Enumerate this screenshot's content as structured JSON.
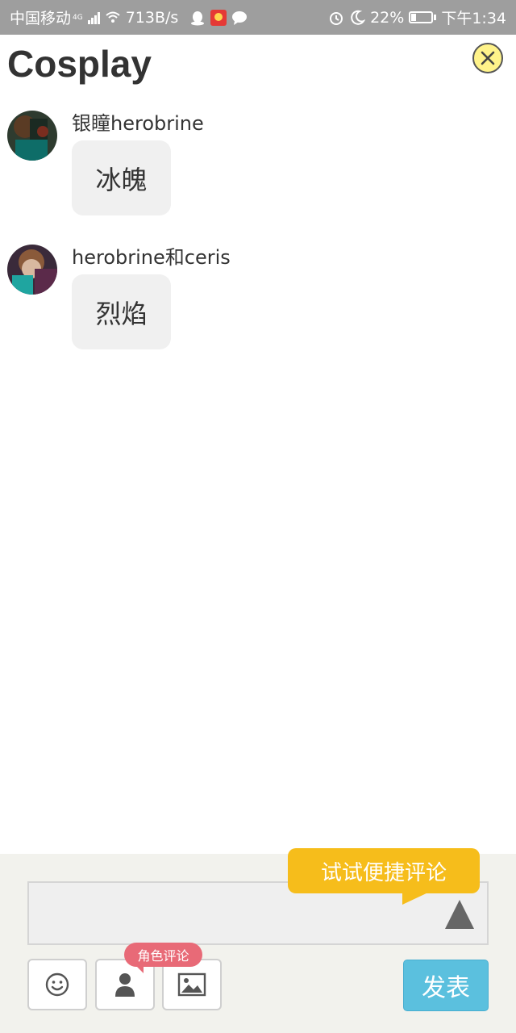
{
  "status_bar": {
    "carrier": "中国移动",
    "network": "4G",
    "speed": "713B/s",
    "battery": "22%",
    "time": "下午1:34",
    "icons": [
      "signal-icon",
      "wifi-icon",
      "qq-icon",
      "app-icon",
      "chat-icon",
      "alarm-icon",
      "moon-icon",
      "battery-icon"
    ]
  },
  "header": {
    "title": "Cosplay",
    "close_icon": "close-icon"
  },
  "comments": [
    {
      "user": "银瞳herobrine",
      "text": "冰魄"
    },
    {
      "user": "herobrine和ceris",
      "text": "烈焰"
    }
  ],
  "composer": {
    "quick_comment_tip": "试试便捷评论",
    "role_comment_badge": "角色评论",
    "publish_label": "发表",
    "tools": [
      "emoji-icon",
      "role-icon",
      "image-icon"
    ],
    "colors": {
      "tip": "#f6bd1b",
      "badge": "#e86a77",
      "publish": "#5bc0de"
    }
  }
}
